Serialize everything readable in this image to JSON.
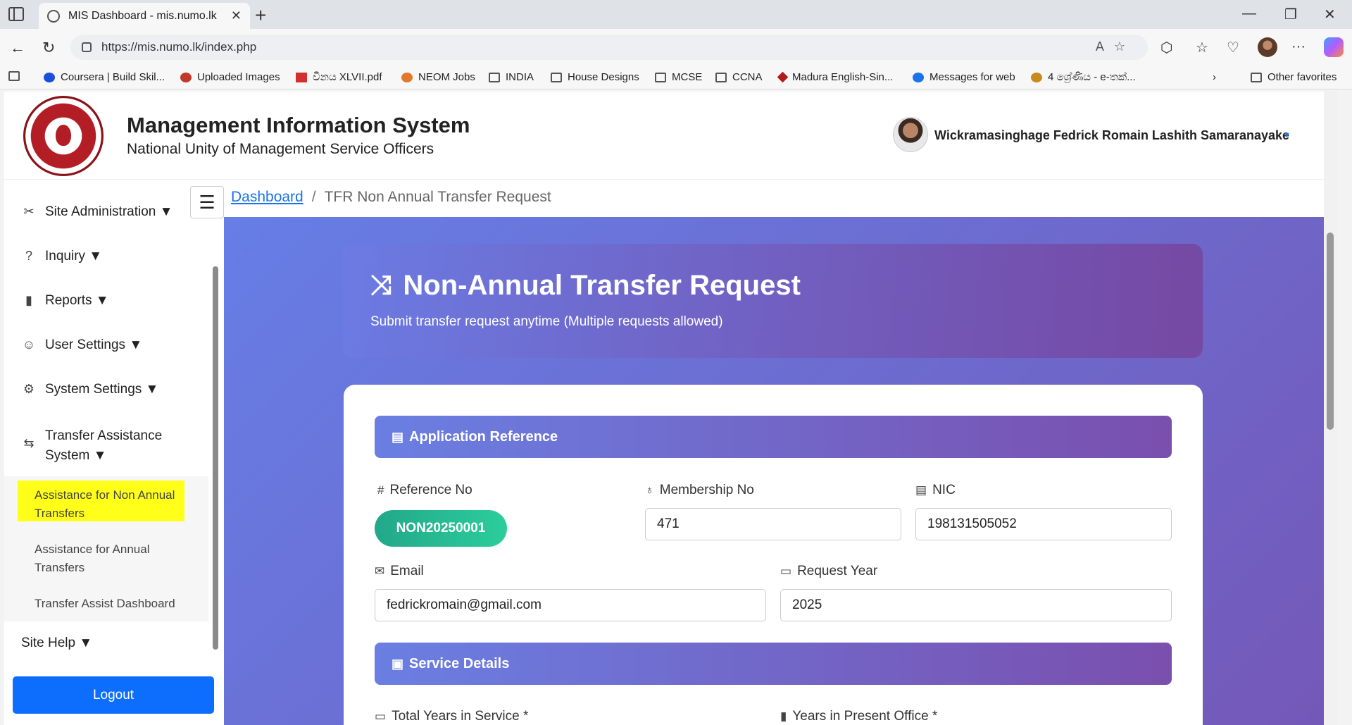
{
  "browser": {
    "tab_title": "MIS Dashboard - mis.numo.lk",
    "url": "https://mis.numo.lk/index.php",
    "favorites": [
      "Coursera | Build Skil...",
      "Uploaded Images",
      "විනය XLVII.pdf",
      "NEOM Jobs",
      "INDIA",
      "House Designs",
      "MCSE",
      "CCNA",
      "Madura English-Sin...",
      "Messages for web",
      "4 ශ්‍රේණිය - e-තක්...",
      "Other favorites"
    ]
  },
  "header": {
    "title": "Management Information System",
    "subtitle": "National Unity of Management Service Officers",
    "user_name": "Wickramasinghage Fedrick Romain Lashith Samaranayake"
  },
  "sidebar": {
    "items": [
      {
        "label": "Site Administration ▼",
        "icon": "tools-icon"
      },
      {
        "label": "Inquiry ▼",
        "icon": "question-icon"
      },
      {
        "label": "Reports ▼",
        "icon": "bar-chart-icon"
      },
      {
        "label": "User Settings ▼",
        "icon": "user-gear-icon"
      },
      {
        "label": "System Settings ▼",
        "icon": "gear-icon"
      },
      {
        "label_line1": "Transfer Assistance",
        "label_line2": "System ▼",
        "icon": "arrows-exchange-icon"
      },
      {
        "label": "Site Help ▼"
      }
    ],
    "submenu": {
      "item1_line1": "Assistance for Non Annual",
      "item1_line2": "Transfers",
      "item2_line1": "Assistance for Annual",
      "item2_line2": "Transfers",
      "item3": "Transfer Assist Dashboard"
    },
    "logout": "Logout"
  },
  "breadcrumb": {
    "home": "Dashboard",
    "separator": "/",
    "current": "TFR Non Annual Transfer Request"
  },
  "hero": {
    "title": "Non-Annual Transfer Request",
    "subtitle": "Submit transfer request anytime (Multiple requests allowed)"
  },
  "form": {
    "section1": "Application Reference",
    "reference_label": "Reference No",
    "reference_value": "NON20250001",
    "membership_label": "Membership No",
    "membership_value": "471",
    "nic_label": "NIC",
    "nic_value": "198131505052",
    "email_label": "Email",
    "email_value": "fedrickromain@gmail.com",
    "year_label": "Request Year",
    "year_value": "2025",
    "section2": "Service Details",
    "total_years_label": "Total Years in Service *",
    "present_office_label": "Years in Present Office *"
  },
  "colors": {
    "accent": "#0d6efd",
    "gradient_start": "#667ee6",
    "gradient_end": "#7458b8",
    "highlight": "#ffff1a"
  }
}
